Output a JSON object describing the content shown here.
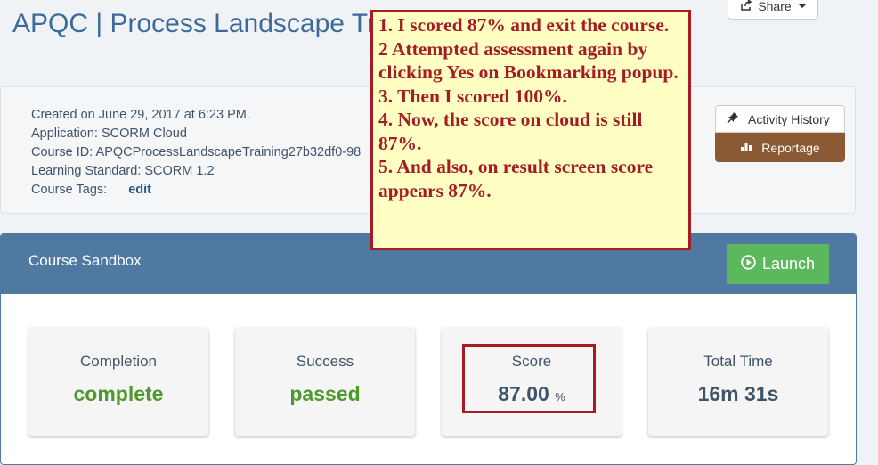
{
  "header": {
    "title": "APQC | Process Landscape Training",
    "share_label": "Share"
  },
  "info": {
    "created": "Created on June 29, 2017 at 6:23 PM.",
    "application": "Application: SCORM Cloud",
    "course_id": "Course ID: APQCProcessLandscapeTraining27b32df0-98",
    "standard": "Learning Standard: SCORM 1.2",
    "tags_label": "Course Tags:",
    "edit_label": "edit"
  },
  "actions": {
    "activity_history": "Activity History",
    "reportage": "Reportage"
  },
  "sandbox": {
    "title": "Course Sandbox",
    "launch_label": "Launch"
  },
  "stats": {
    "completion": {
      "label": "Completion",
      "value": "complete"
    },
    "success": {
      "label": "Success",
      "value": "passed"
    },
    "score": {
      "label": "Score",
      "value": "87.00",
      "unit": "%"
    },
    "total_time": {
      "label": "Total Time",
      "value": "16m 31s"
    }
  },
  "annotation": {
    "lines": [
      "1. I scored 87% and exit the course.",
      "2 Attempted assessment again by clicking Yes on Bookmarking popup.",
      "3. Then I scored 100%.",
      "4. Now, the score on cloud is still 87%.",
      "5. And also, on result screen score appears 87%."
    ]
  },
  "colors": {
    "title_blue": "#3d6a9b",
    "sandbox_header": "#4f79a1",
    "launch_green": "#5cb85c",
    "reportage_brown": "#8b5a34",
    "annotation_red": "#a51c24",
    "annotation_bg": "#ffffc4",
    "status_green": "#4c9a2a"
  }
}
